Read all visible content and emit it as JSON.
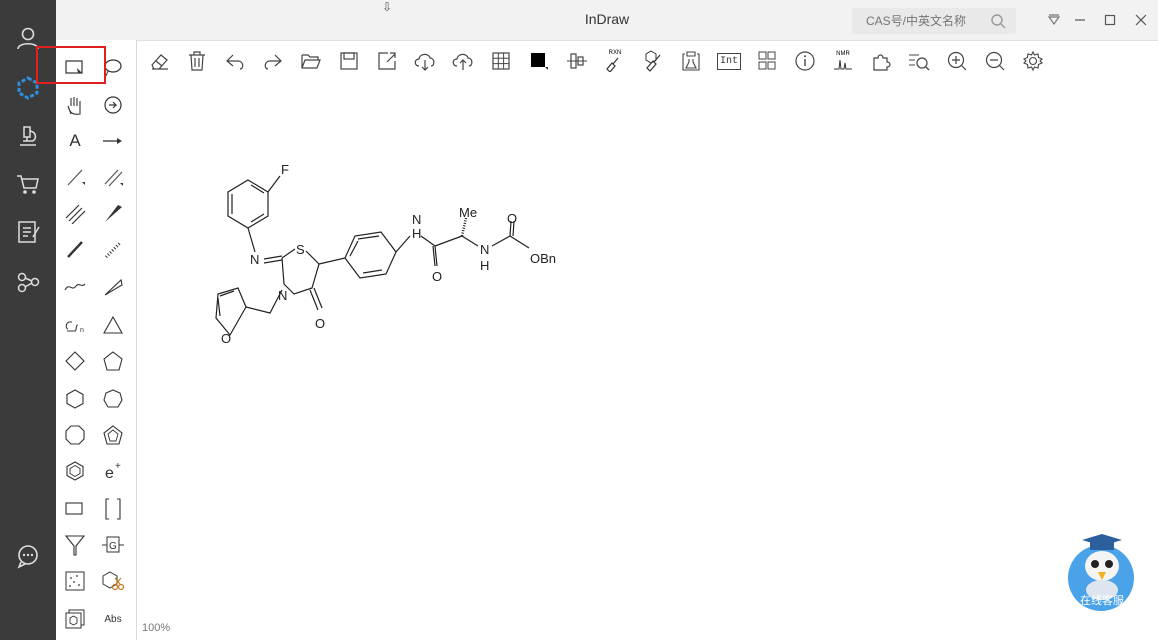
{
  "app": {
    "title": "InDraw"
  },
  "search": {
    "placeholder": "CAS号/中英文名称"
  },
  "status": {
    "zoom": "100%"
  },
  "tools": {
    "abs_label": "Abs",
    "text_tool_label": "A"
  },
  "toolbar": {
    "rxn_label": "RXN",
    "int_label": "Int",
    "nmr_label": "NMR"
  },
  "chat": {
    "label": "在线客服"
  },
  "molecule": {
    "atoms": {
      "F": "F",
      "N_imine": "N",
      "S": "S",
      "N_ring": "N",
      "O_carbonyl": "O",
      "O_furan": "O",
      "NH_top": "N",
      "H_top": "H",
      "Me": "Me",
      "O_amide": "O",
      "NH_bottom": "N",
      "H_bottom": "H",
      "O_top": "O",
      "OBn": "OBn"
    }
  },
  "colors": {
    "sidebar": "#3b3b3b",
    "accent": "#2f8fe0",
    "highlight": "#e02020"
  }
}
